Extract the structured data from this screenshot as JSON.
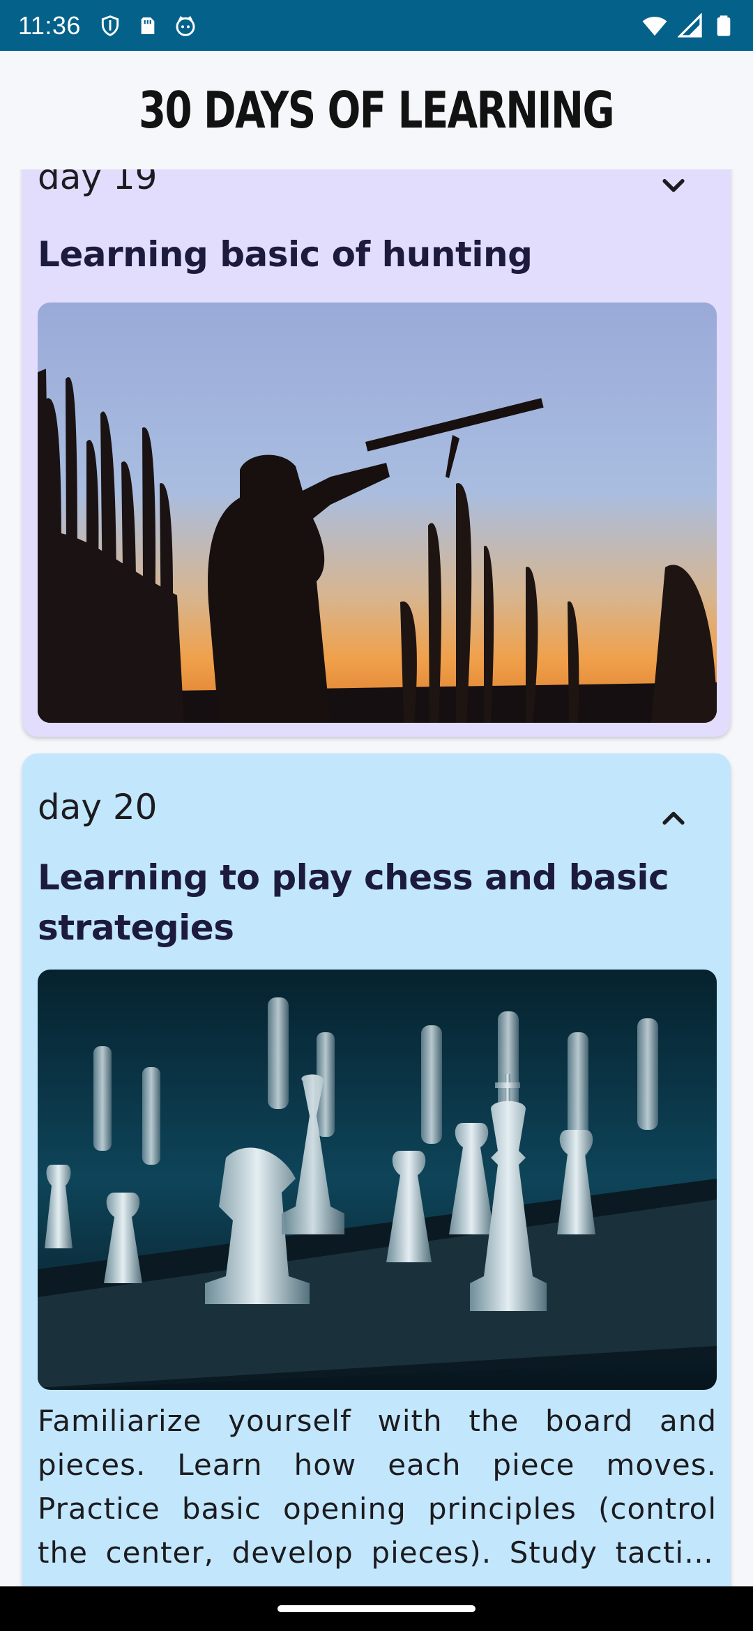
{
  "status_bar": {
    "time": "11:36",
    "icons_left": [
      "shield-icon",
      "sim-card-icon",
      "cat-face-icon"
    ],
    "icons_right": [
      "wifi-icon",
      "signal-icon",
      "battery-icon"
    ]
  },
  "app_bar": {
    "title": "30 DAYS OF LEARNING"
  },
  "cards": [
    {
      "day": "day 19",
      "title": "Learning basic of hunting",
      "expanded": false,
      "chevron": "chevron-down-icon",
      "background": "#e2dcfd"
    },
    {
      "day": "day 20",
      "title": "Learning to play chess and basic strategies",
      "expanded": true,
      "chevron": "chevron-up-icon",
      "background": "#c2e7fc",
      "description": "Familiarize yourself with the board and pieces. Learn how each piece moves. Practice basic opening principles (control the center, develop pieces). Study tactics like forks and pins."
    }
  ],
  "colors": {
    "status_bar": "#04618a",
    "accent_text": "#1d1b3d"
  }
}
